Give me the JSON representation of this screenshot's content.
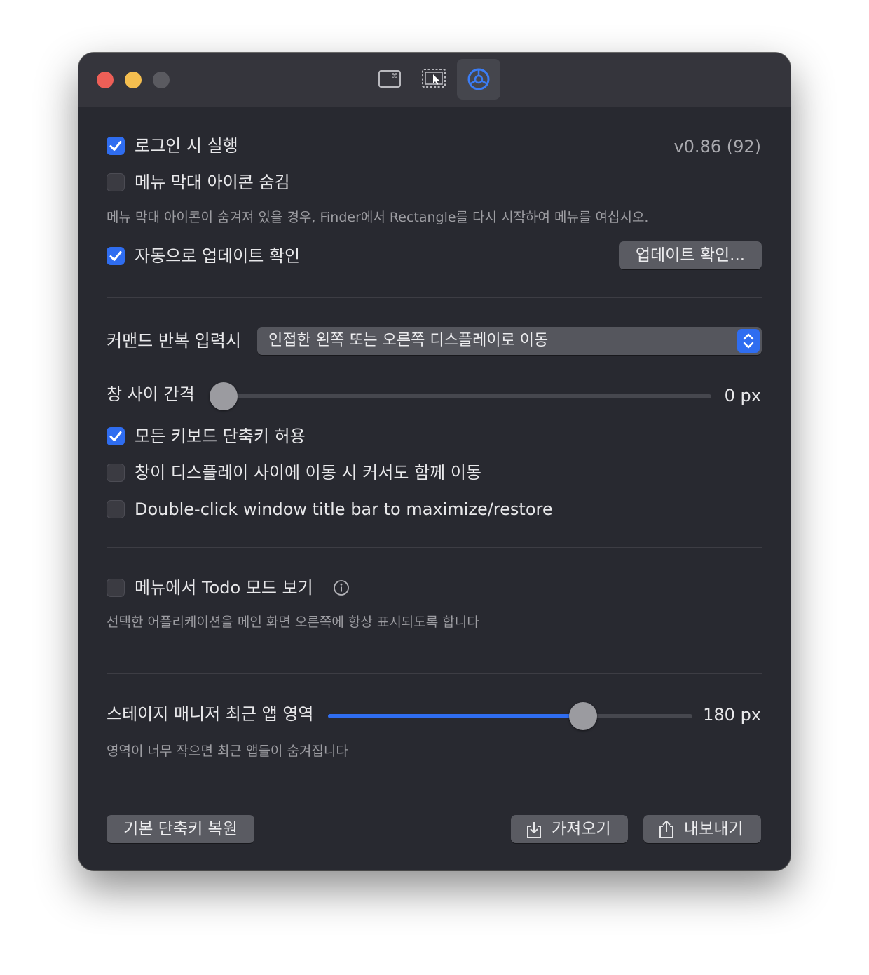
{
  "toolbar": {
    "tabs": [
      {
        "name": "keyboard-shortcuts-icon"
      },
      {
        "name": "snap-areas-icon"
      },
      {
        "name": "settings-gear-icon",
        "active": true
      }
    ]
  },
  "general": {
    "launch_on_login": {
      "label": "로그인 시 실행",
      "checked": true
    },
    "version": "v0.86 (92)",
    "hide_menu_icon": {
      "label": "메뉴 막대 아이콘 숨김",
      "checked": false
    },
    "hide_menu_icon_note": "메뉴 막대 아이콘이 숨겨져 있을 경우, Finder에서 Rectangle를 다시 시작하여 메뉴를 여십시오.",
    "auto_update": {
      "label": "자동으로 업데이트 확인",
      "checked": true
    },
    "check_updates_button": "업데이트 확인..."
  },
  "behavior": {
    "repeat_command_label": "커맨드 반복 입력시",
    "repeat_command_value": "인접한 왼쪽 또는 오른쪽 디스플레이로 이동",
    "gap_label": "창 사이 간격",
    "gap_value": 0,
    "gap_value_text": "0 px",
    "allow_all_shortcuts": {
      "label": "모든 키보드 단축키 허용",
      "checked": true
    },
    "move_cursor": {
      "label": "창이 디스플레이 사이에 이동 시 커서도 함께 이동",
      "checked": false
    },
    "double_click_title": {
      "label": "Double-click window title bar to maximize/restore",
      "checked": false
    }
  },
  "todo": {
    "show_todo": {
      "label": "메뉴에서 Todo 모드 보기",
      "checked": false
    },
    "note": "선택한 어플리케이션을 메인 화면 오른쪽에 항상 표시되도록 합니다"
  },
  "stage_manager": {
    "label": "스테이지 매니저 최근 앱 영역",
    "value_fraction": 0.7,
    "value_text": "180 px",
    "note": "영역이 너무 작으면 최근 앱들이 숨겨집니다"
  },
  "footer": {
    "restore_defaults_button": "기본 단축키 복원",
    "import_button": "가져오기",
    "export_button": "내보내기"
  },
  "colors": {
    "accent": "#2f6df0",
    "window_bg": "#282930",
    "titlebar_bg": "#35353c"
  }
}
